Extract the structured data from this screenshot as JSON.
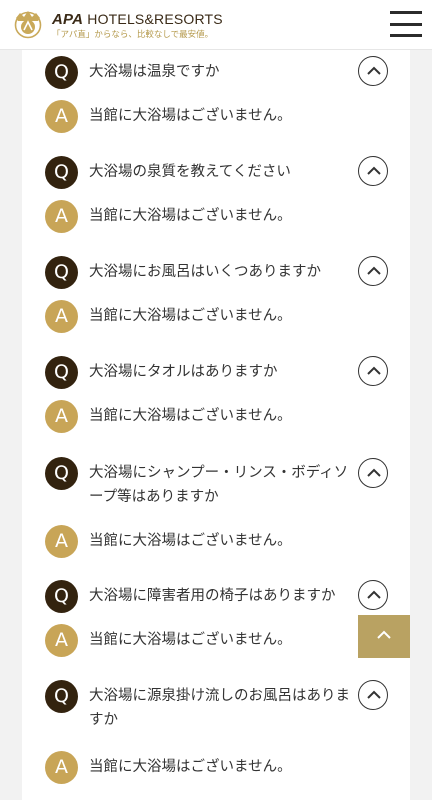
{
  "header": {
    "brand_prefix": "APA",
    "brand_suffix": " HOTELS&RESORTS",
    "tagline": "「アパ直」からなら、比較なしで最安値。",
    "accent_color": "#b59a4d"
  },
  "faq": [
    {
      "question": "大浴場は温泉ですか",
      "answer": "当館に大浴場はございません。"
    },
    {
      "question": "大浴場の泉質を教えてください",
      "answer": "当館に大浴場はございません。"
    },
    {
      "question": "大浴場にお風呂はいくつありますか",
      "answer": "当館に大浴場はございません。"
    },
    {
      "question": "大浴場にタオルはありますか",
      "answer": "当館に大浴場はございません。"
    },
    {
      "question": "大浴場にシャンプー・リンス・ボディソープ等はありますか",
      "answer": "当館に大浴場はございません。"
    },
    {
      "question": "大浴場に障害者用の椅子はありますか",
      "answer": "当館に大浴場はございません。"
    },
    {
      "question": "大浴場に源泉掛け流しのお風呂はありますか",
      "answer": "当館に大浴場はございません。"
    }
  ],
  "badges": {
    "q": "Q",
    "a": "A"
  },
  "colors": {
    "q_badge": "#33230f",
    "a_badge": "#c8a557",
    "back_to_top": "#b9a262"
  },
  "icons": {
    "menu": "hamburger-icon",
    "toggle": "chevron-up-icon",
    "back_to_top": "chevron-up-icon"
  }
}
